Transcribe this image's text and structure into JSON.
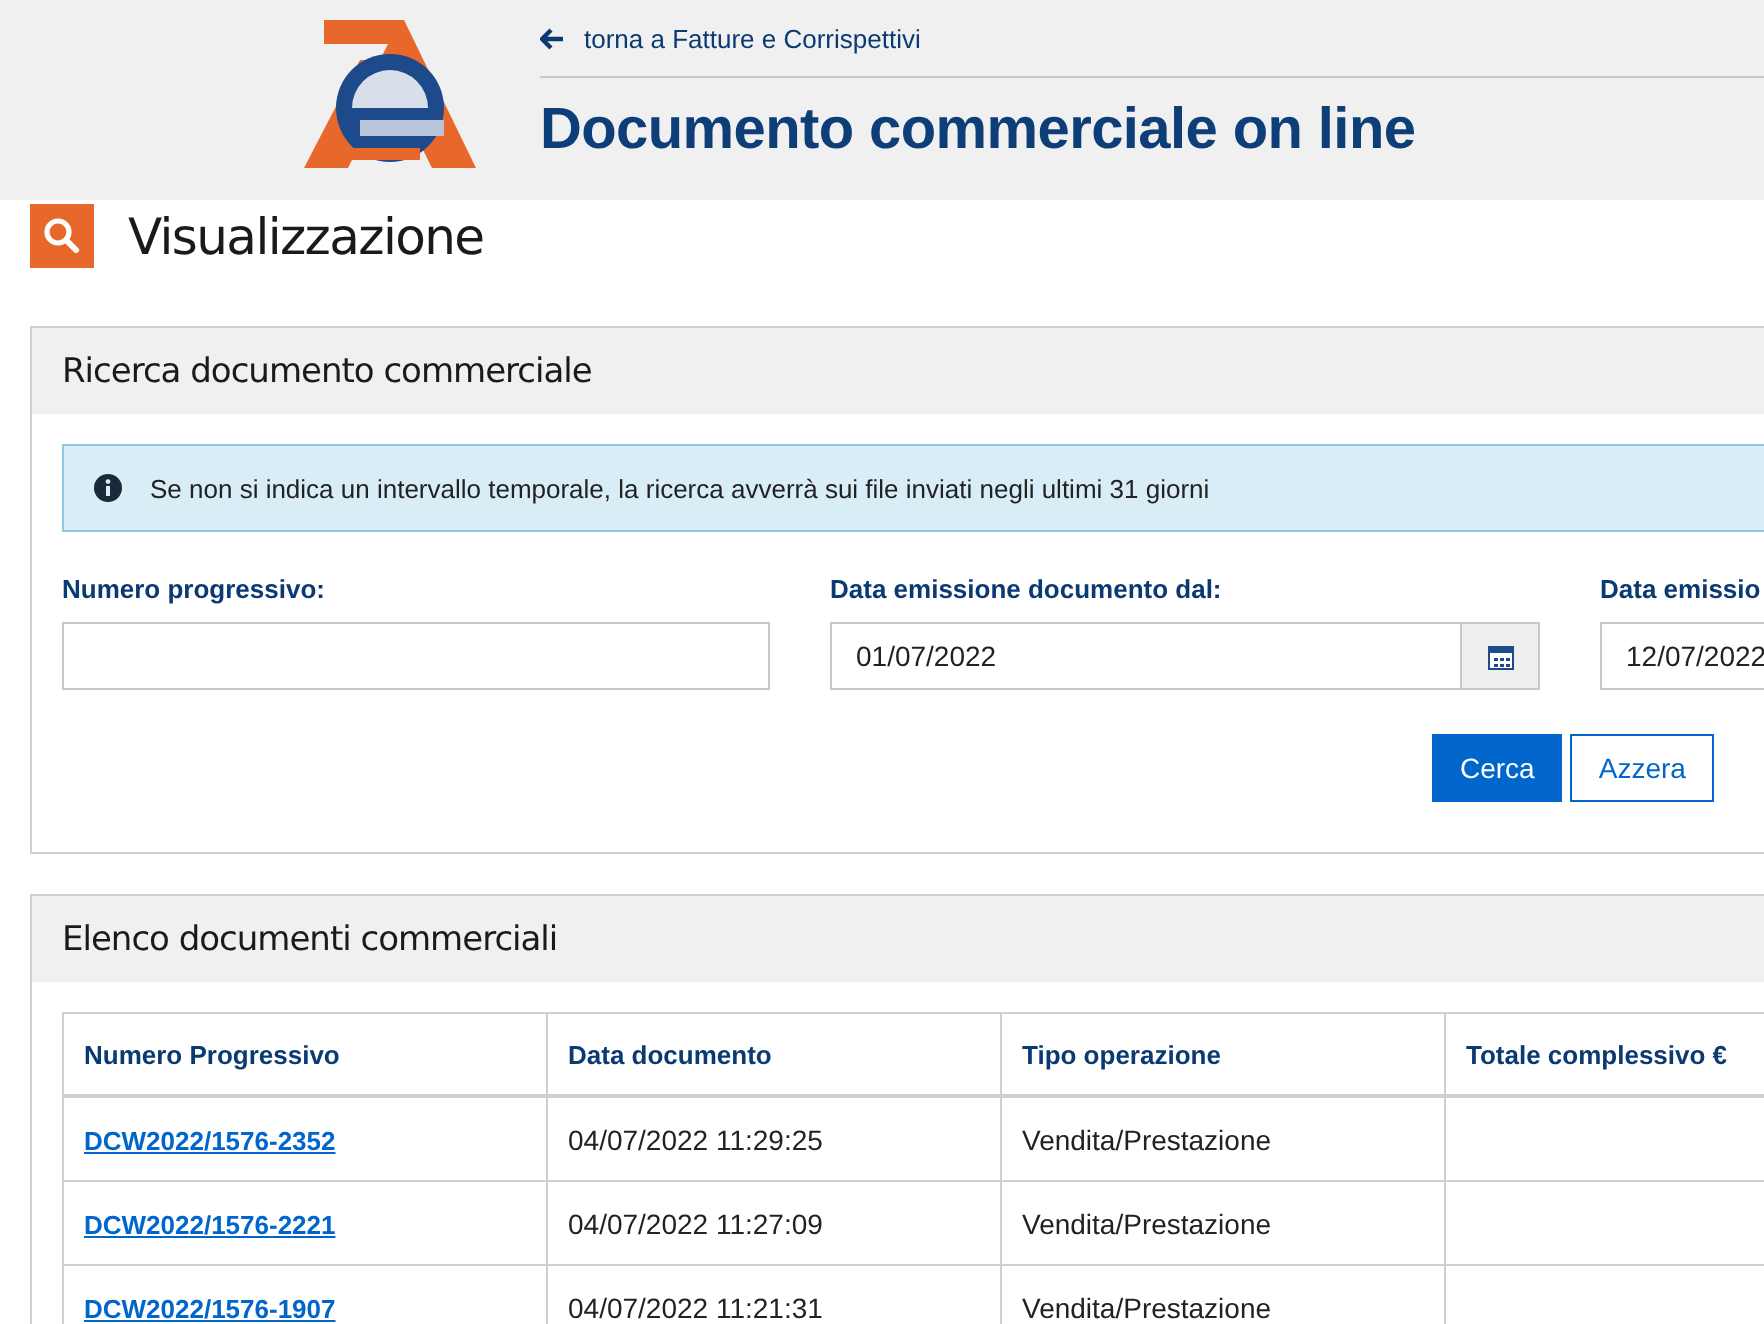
{
  "header": {
    "back_link": "torna a Fatture e Corrispettivi",
    "title": "Documento commerciale on line"
  },
  "page_title": "Visualizzazione",
  "search_panel": {
    "title": "Ricerca documento commerciale",
    "info": "Se non si indica un intervallo temporale, la ricerca avverrà sui file inviati negli ultimi 31 giorni",
    "fields": [
      {
        "label": "Numero progressivo:",
        "kind": "text"
      },
      {
        "label": "Data emissione documento dal:",
        "kind": "date",
        "value": "01/07/2022"
      },
      {
        "label": "Data emissio",
        "kind": "date",
        "value": "12/07/2022"
      }
    ],
    "buttons": [
      {
        "label": "Cerca",
        "kind": "primary"
      },
      {
        "label": "Azzera",
        "kind": "secondary"
      }
    ]
  },
  "list_panel": {
    "title": "Elenco documenti commerciali",
    "table": {
      "columns": [
        "Numero Progressivo",
        "Data documento",
        "Tipo operazione",
        "Totale complessivo €"
      ],
      "rows": [
        {
          "number": "DCW2022/1576-2352",
          "date": "04/07/2022 11:29:25",
          "type": "Vendita/Prestazione"
        },
        {
          "number": "DCW2022/1576-2221",
          "date": "04/07/2022 11:27:09",
          "type": "Vendita/Prestazione"
        },
        {
          "number": "DCW2022/1576-1907",
          "date": "04/07/2022 11:21:31",
          "type": "Vendita/Prestazione"
        }
      ]
    }
  }
}
